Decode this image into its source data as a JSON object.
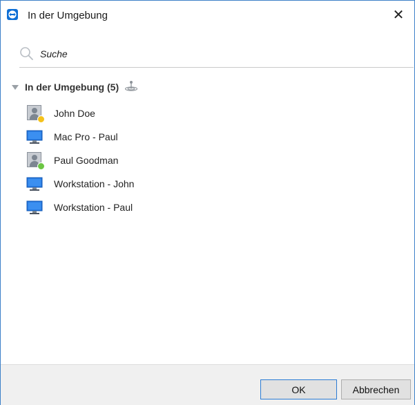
{
  "window": {
    "title": "In der Umgebung",
    "close_glyph": "✕",
    "app_icon": "teamviewer-icon"
  },
  "search": {
    "placeholder": "Suche",
    "value": ""
  },
  "group": {
    "label": "In der Umgebung (5)",
    "icon": "radar-icon"
  },
  "items": [
    {
      "label": "John Doe",
      "type": "contact",
      "status": "away",
      "status_color": "#f5c21b"
    },
    {
      "label": "Mac Pro - Paul",
      "type": "computer"
    },
    {
      "label": "Paul Goodman",
      "type": "contact",
      "status": "online",
      "status_color": "#6cc644"
    },
    {
      "label": "Workstation - John",
      "type": "computer"
    },
    {
      "label": "Workstation - Paul",
      "type": "computer"
    }
  ],
  "buttons": {
    "ok": "OK",
    "cancel": "Abbrechen"
  },
  "colors": {
    "accent": "#0e6fd6",
    "window_border": "#3c80c8"
  }
}
